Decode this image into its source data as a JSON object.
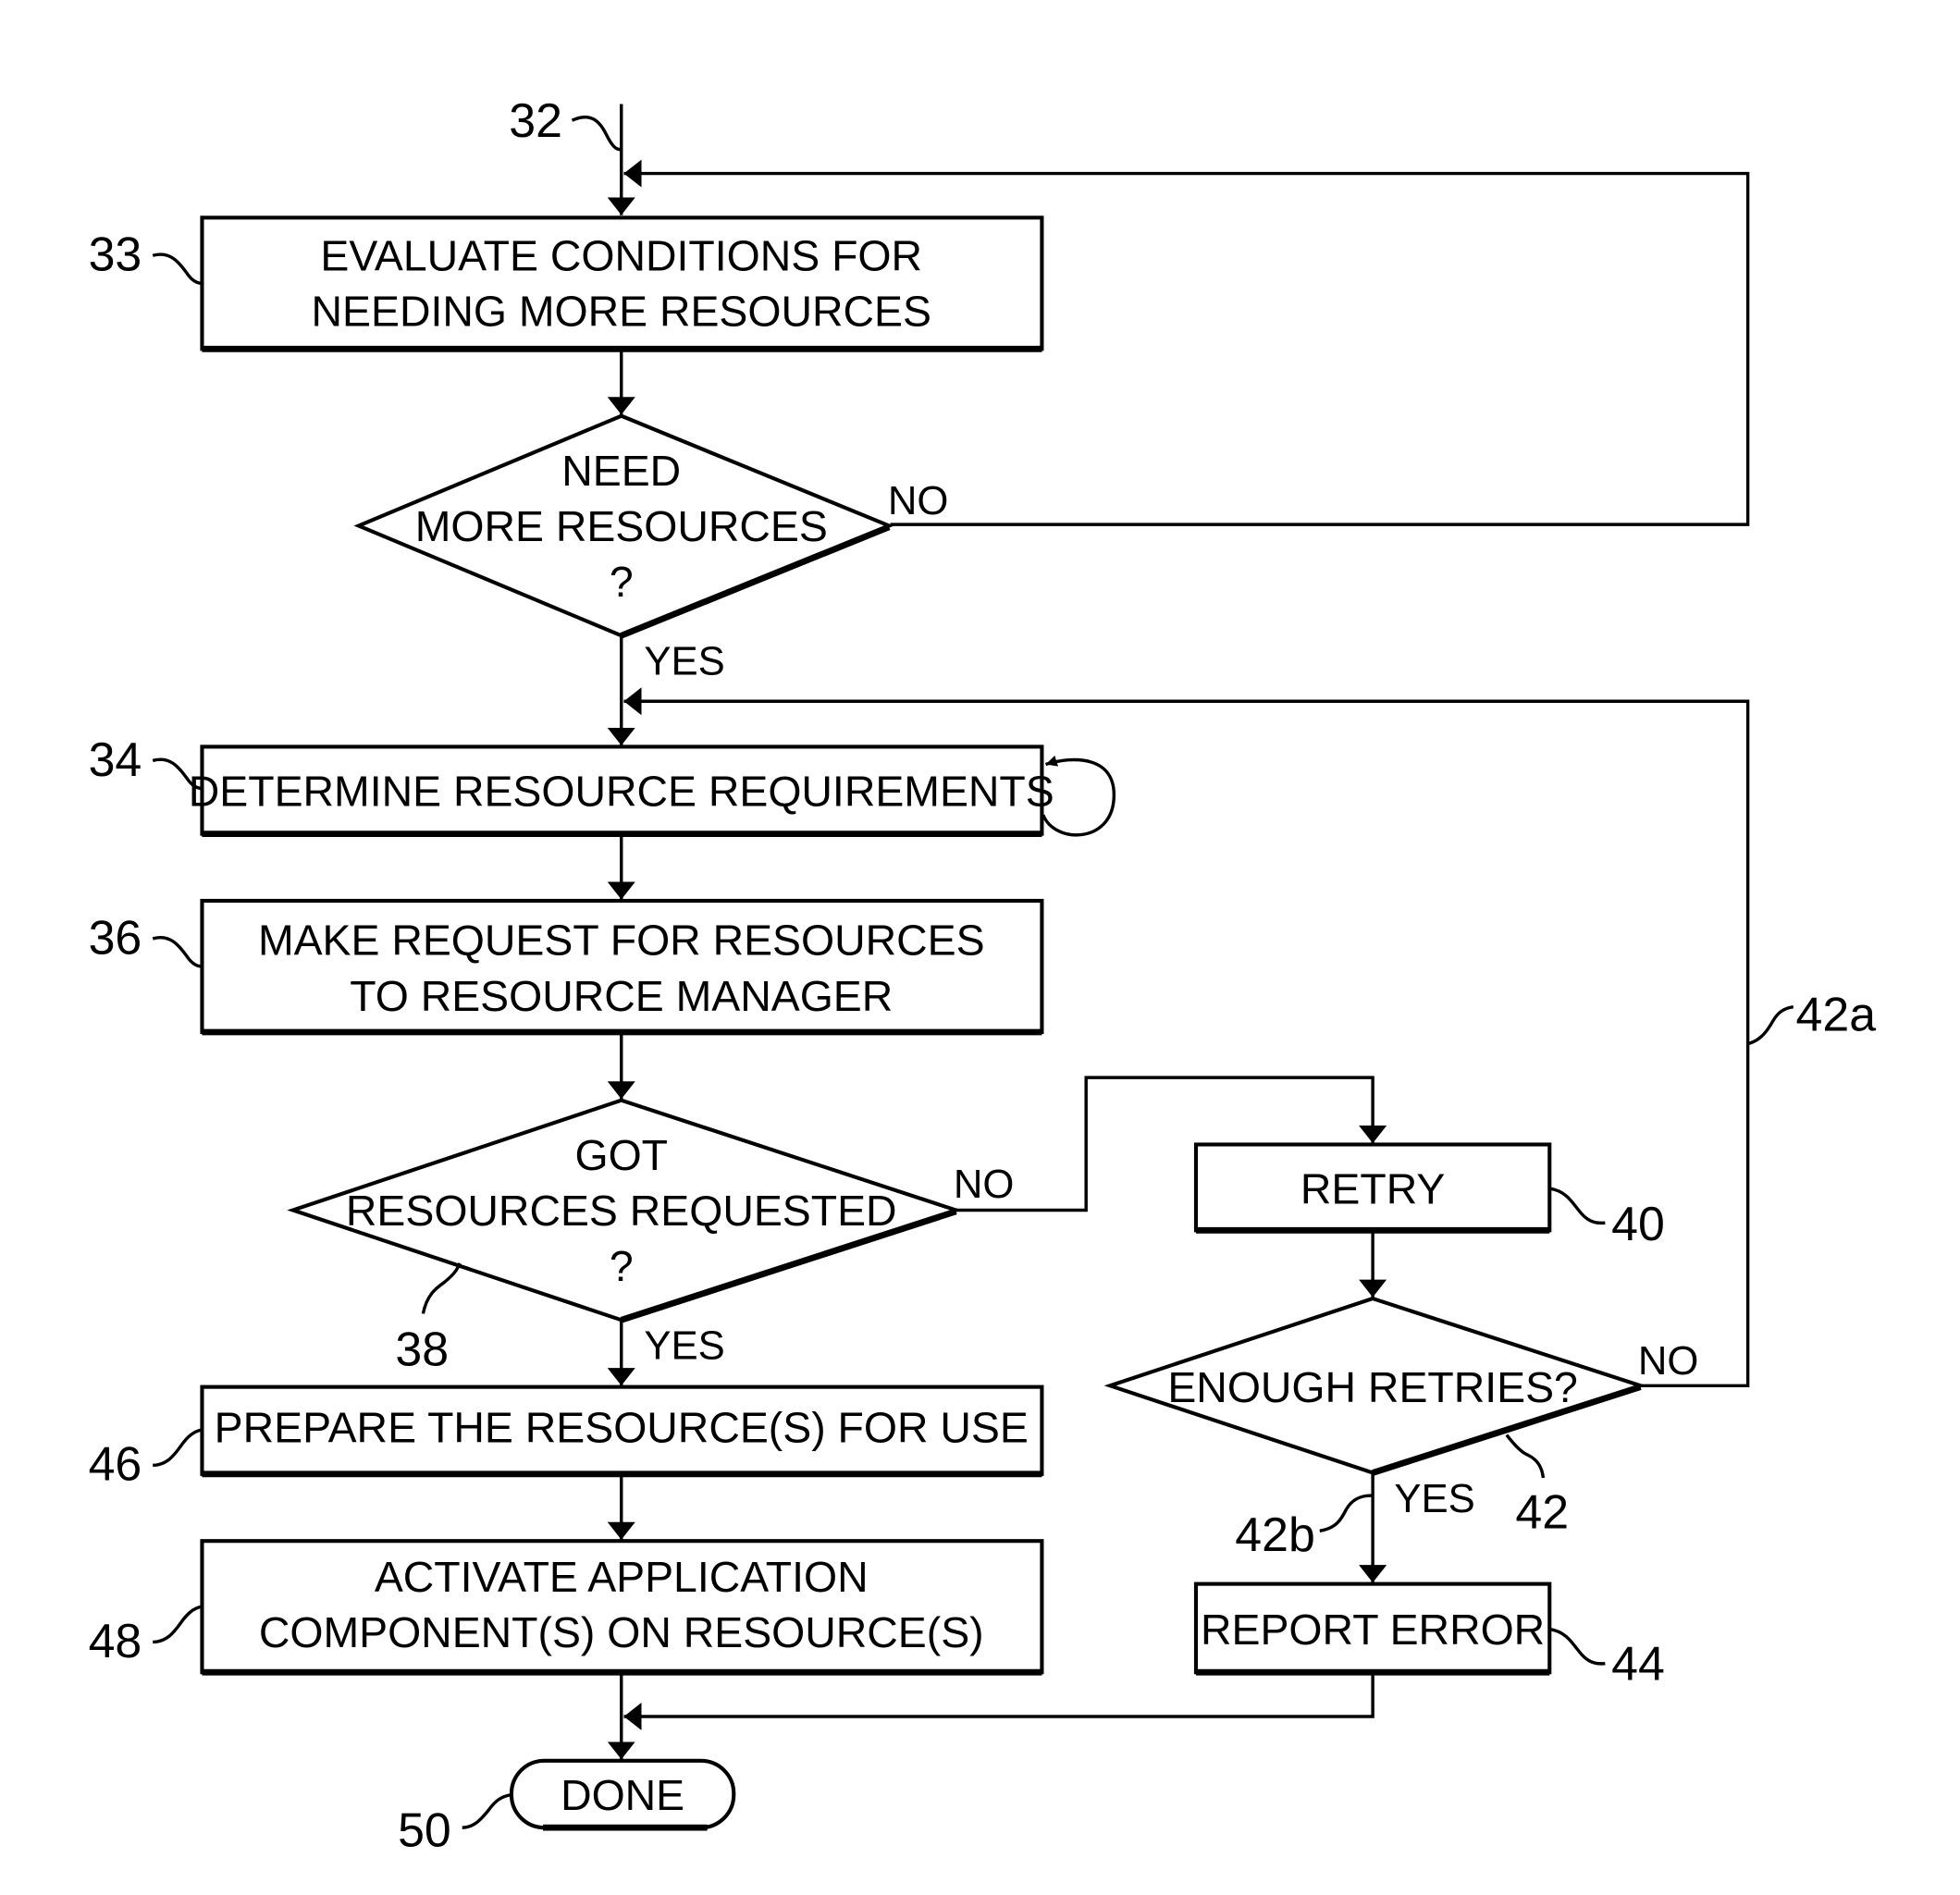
{
  "diagram": {
    "type": "flowchart",
    "start_ref": "32",
    "steps": {
      "evaluate": {
        "ref": "33",
        "lines": [
          "EVALUATE CONDITIONS FOR",
          "NEEDING MORE RESOURCES"
        ]
      },
      "need_more": {
        "ref": "",
        "lines": [
          "NEED",
          "MORE RESOURCES",
          "?"
        ],
        "no_label": "NO",
        "yes_label": "YES"
      },
      "determine": {
        "ref": "34",
        "lines": [
          "DETERMINE RESOURCE REQUIREMENTS"
        ]
      },
      "make_request": {
        "ref": "36",
        "lines": [
          "MAKE REQUEST FOR RESOURCES",
          "TO RESOURCE MANAGER"
        ]
      },
      "got_resources": {
        "ref": "38",
        "lines": [
          "GOT",
          "RESOURCES REQUESTED",
          "?"
        ],
        "no_label": "NO",
        "yes_label": "YES"
      },
      "retry": {
        "ref": "40",
        "lines": [
          "RETRY"
        ]
      },
      "enough_retries": {
        "ref": "42",
        "lines": [
          "ENOUGH RETRIES?"
        ],
        "no_label": "NO",
        "yes_label": "YES",
        "no_ref": "42a",
        "yes_ref": "42b"
      },
      "prepare": {
        "ref": "46",
        "lines": [
          "PREPARE THE RESOURCE(S) FOR USE"
        ]
      },
      "activate": {
        "ref": "48",
        "lines": [
          "ACTIVATE APPLICATION",
          "COMPONENT(S) ON RESOURCE(S)"
        ]
      },
      "report_error": {
        "ref": "44",
        "lines": [
          "REPORT ERROR"
        ]
      },
      "done": {
        "ref": "50",
        "lines": [
          "DONE"
        ]
      }
    }
  }
}
